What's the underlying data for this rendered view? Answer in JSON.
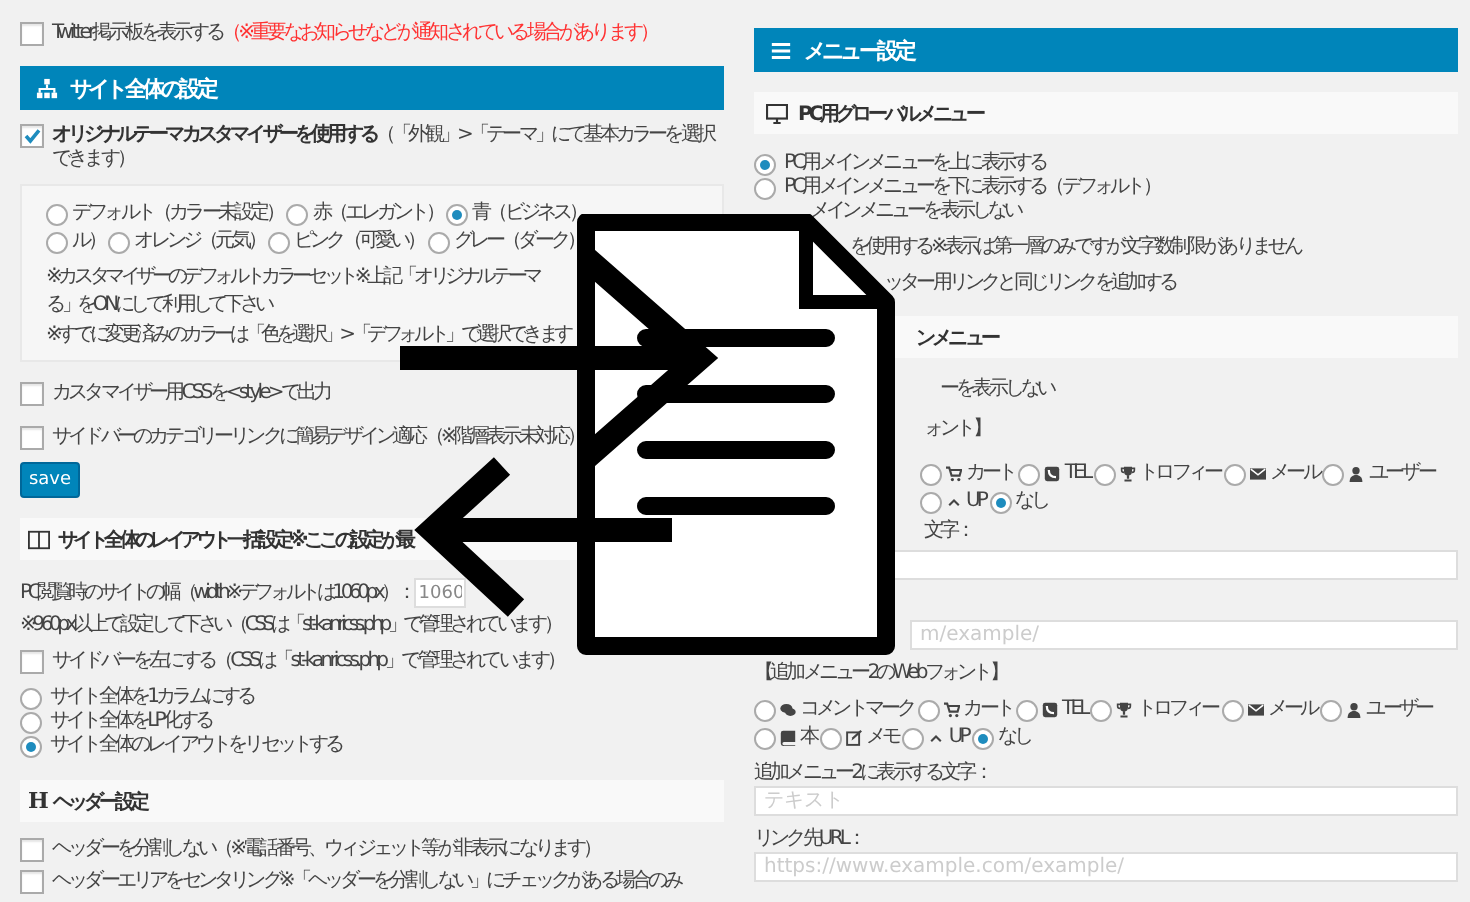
{
  "left": {
    "twitter": {
      "label": "Twitter掲示板を表示する",
      "note": "（※重要なお知らせなどが通知されている場合があります）",
      "checked": false
    },
    "site_header": "サイト全体の設定",
    "customizer": {
      "label": "オリジナルテーマカスタマイザーを使用する",
      "note": "（「外観」>「テーマ」にて基本カラーを選択できます）",
      "checked": true
    },
    "color_options": [
      {
        "label": "デフォルト（カラー未設定）",
        "selected": false
      },
      {
        "label": "赤（エレガント）",
        "selected": false
      },
      {
        "label": "青（ビジネス）",
        "selected": true
      },
      {
        "label": "ル）",
        "selected": false
      },
      {
        "label": "オレンジ（元気）",
        "selected": false
      },
      {
        "label": "ピンク（可愛い）",
        "selected": false
      },
      {
        "label": "グレー（ダーク）",
        "selected": false
      }
    ],
    "panel_notes": [
      "※カスタマイザーのデフォルトカラーセット※上記「オリジナルテーマ",
      "る」をONにして利用して下さい",
      "※すでに変更済みのカラーは「色を選択」>「デフォルト」で選択できます"
    ],
    "checkboxes": [
      {
        "label": "カスタマイザー用CSSを<style>で出力",
        "checked": false
      },
      {
        "label": "サイドバーのカテゴリーリンクに簡易デザイン適応（※階層表示未対応）",
        "checked": false
      }
    ],
    "save_button": "save",
    "layout_header": "サイト全体のレイアウト一括設定※ここの設定が最",
    "width_field": {
      "label": "PC閲覧時のサイトの幅（width※デフォルトは1060px）：",
      "value": "1060"
    },
    "width_note": "※960px以上で設定して下さい（CSSは「st-kanricss.php」で管理されています）",
    "sidebar_left": {
      "label": "サイドバーを左にする（CSSは「st-kanricss.php」で管理されています）",
      "checked": false
    },
    "layout_options": [
      {
        "label": "サイト全体を1カラムにする",
        "selected": false
      },
      {
        "label": "サイト全体をLP化する",
        "selected": false
      },
      {
        "label": "サイト全体のレイアウトをリセットする",
        "selected": true
      }
    ],
    "header_icon": "H",
    "header_settings": "ヘッダー設定",
    "header_checkboxes": [
      {
        "label": "ヘッダーを分割しない（※電話番号、ウィジェット等が非表示になります）",
        "checked": false
      },
      {
        "label": "ヘッダーエリアをセンタリング※「ヘッダーを分割しない」にチェックがある場合のみ",
        "checked": false
      }
    ]
  },
  "right": {
    "menu_header": "メニュー設定",
    "pc_menu_header": "PC用グローバルメニュー",
    "pc_menu_options": [
      {
        "label": "PC用メインメニューを上に表示する",
        "selected": true
      },
      {
        "label": "PC用メインメニューを下に表示する（デフォルト）",
        "selected": false
      }
    ],
    "fragment_hide_menu": "メインメニューを表示しない",
    "fragment_use": "を使用する※表示は第一層のみですが文字数制限がありません",
    "fragment_link": {
      "label": "ッター用リンクと同じリンクを追加する"
    },
    "sub_header_fragment": "ンメニュー",
    "fragment_hide": "ーを表示しない",
    "fragment_font": "ォント】",
    "menu1_icons": [
      {
        "kind": "cart",
        "label": "カート",
        "selected": false
      },
      {
        "kind": "tel",
        "label": "TEL",
        "selected": false
      },
      {
        "kind": "trophy",
        "label": "トロフィー",
        "selected": false
      },
      {
        "kind": "mail",
        "label": "メール",
        "selected": false
      },
      {
        "kind": "user",
        "label": "ユーザー",
        "selected": false
      },
      {
        "kind": "up",
        "label": "UP",
        "selected": false
      },
      {
        "kind": "none",
        "label": "なし",
        "selected": true
      }
    ],
    "menu1_text_label": "文字：",
    "menu1_url_placeholder": "m/example/",
    "menu2_font_label": "【追加メニュー2のWebフォント】",
    "menu2_icons": [
      {
        "kind": "comment",
        "label": "コメントマーク",
        "selected": false
      },
      {
        "kind": "cart",
        "label": "カート",
        "selected": false
      },
      {
        "kind": "tel",
        "label": "TEL",
        "selected": false
      },
      {
        "kind": "trophy",
        "label": "トロフィー",
        "selected": false
      },
      {
        "kind": "mail",
        "label": "メール",
        "selected": false
      },
      {
        "kind": "user",
        "label": "ユーザー",
        "selected": false
      },
      {
        "kind": "book",
        "label": "本",
        "selected": false
      },
      {
        "kind": "memo",
        "label": "メモ",
        "selected": false
      },
      {
        "kind": "up",
        "label": "UP",
        "selected": false
      },
      {
        "kind": "none",
        "label": "なし",
        "selected": true
      }
    ],
    "menu2_text": {
      "label": "追加メニュー2に表示する文字：",
      "placeholder": "テキスト"
    },
    "menu2_url": {
      "label": "リンク先URL：",
      "placeholder": "https://www.example.com/example/"
    }
  }
}
